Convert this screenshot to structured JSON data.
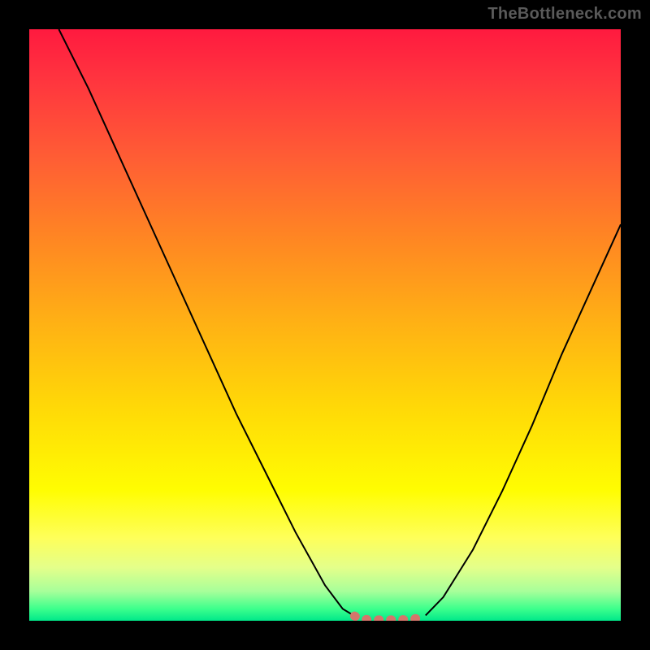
{
  "watermark": {
    "text": "TheBottleneck.com"
  },
  "chart_data": {
    "type": "line",
    "title": "",
    "xlabel": "",
    "ylabel": "",
    "xlim": [
      0,
      100
    ],
    "ylim": [
      0,
      100
    ],
    "series": [
      {
        "name": "left-branch",
        "x": [
          5,
          10,
          15,
          20,
          25,
          30,
          35,
          40,
          45,
          50,
          53,
          55
        ],
        "y": [
          100,
          90,
          79,
          68,
          57,
          46,
          35,
          25,
          15,
          6,
          2,
          0.8
        ]
      },
      {
        "name": "valley-marker",
        "x": [
          55,
          56,
          57,
          58,
          60,
          62,
          64,
          65,
          66,
          67
        ],
        "y": [
          0.8,
          0.4,
          0.2,
          0.15,
          0.15,
          0.15,
          0.2,
          0.3,
          0.5,
          0.9
        ]
      },
      {
        "name": "right-branch",
        "x": [
          67,
          70,
          75,
          80,
          85,
          90,
          95,
          100
        ],
        "y": [
          0.9,
          4,
          12,
          22,
          33,
          45,
          56,
          67
        ]
      }
    ],
    "colors": {
      "curve": "#000000",
      "valley_marker": "#d4756b",
      "gradient_top": "#ff1a3f",
      "gradient_bottom": "#00e88a"
    }
  }
}
